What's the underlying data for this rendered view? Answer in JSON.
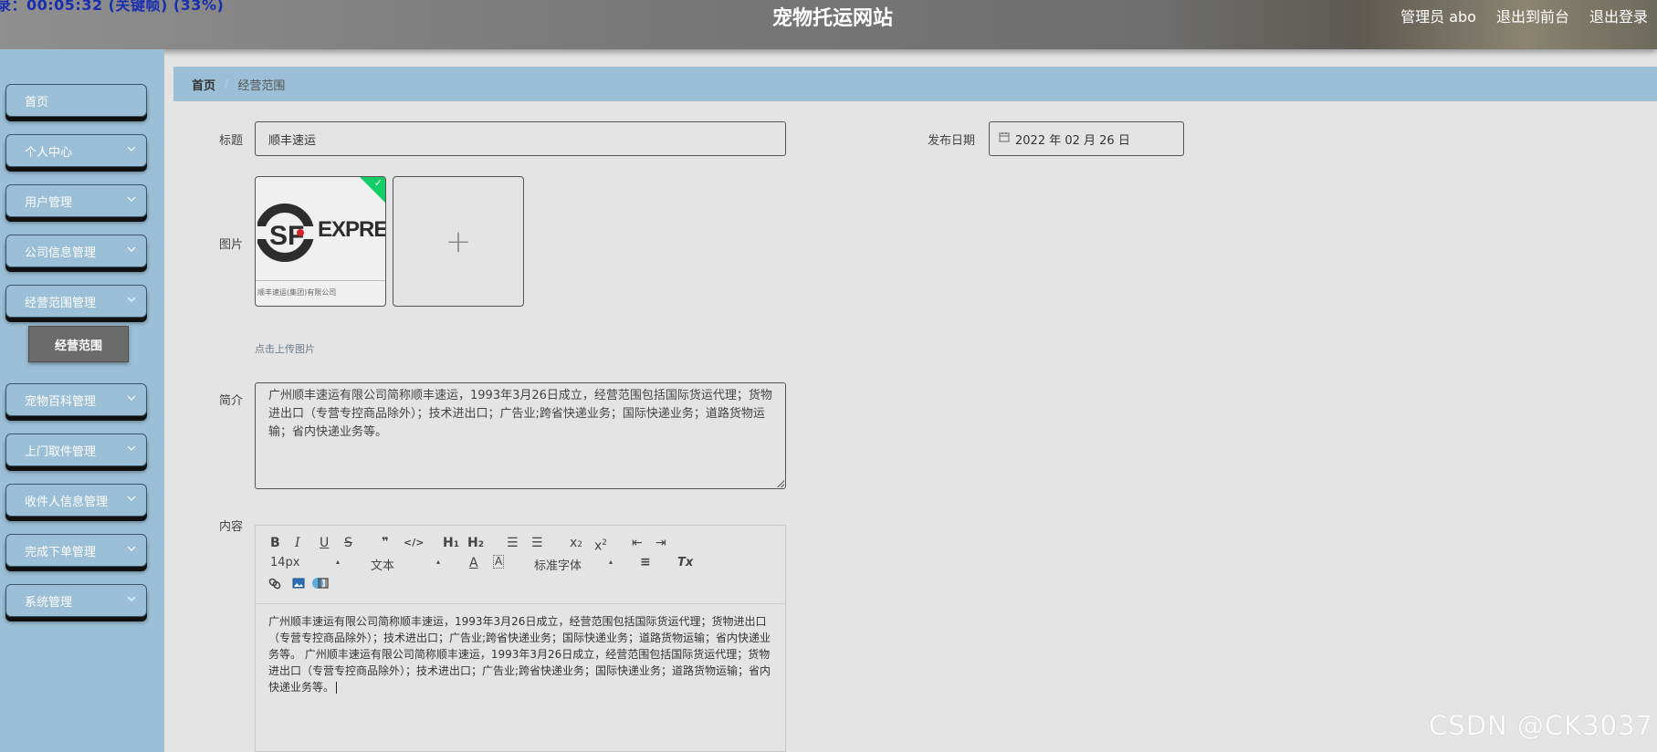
{
  "header": {
    "timer": "录：00:05:32 (关键帧) (33%)",
    "site_title": "宠物托运网站",
    "nav": {
      "user": "管理员 abo",
      "frontend": "退出到前台",
      "logout": "退出登录"
    }
  },
  "sidebar": {
    "items": [
      {
        "label": "首页",
        "has_arrow": false
      },
      {
        "label": "个人中心",
        "has_arrow": true
      },
      {
        "label": "用户管理",
        "has_arrow": true
      },
      {
        "label": "公司信息管理",
        "has_arrow": true
      },
      {
        "label": "经营范围管理",
        "has_arrow": true
      },
      {
        "label": "宠物百科管理",
        "has_arrow": true
      },
      {
        "label": "上门取件管理",
        "has_arrow": true
      },
      {
        "label": "收件人信息管理",
        "has_arrow": true
      },
      {
        "label": "完成下单管理",
        "has_arrow": true
      },
      {
        "label": "系统管理",
        "has_arrow": true
      }
    ],
    "submenu": {
      "label": "经营范围"
    }
  },
  "breadcrumb": {
    "home": "首页",
    "separator": "/",
    "current": "经营范围"
  },
  "form": {
    "title_label": "标题",
    "title_value": "顺丰速运",
    "date_label": "发布日期",
    "date_value": "2022 年 02 月 26 日",
    "image_label": "图片",
    "image": {
      "logo_text": "EXPRESS",
      "logo_letters": "SF",
      "caption": "顺丰速运(集团)有限公司"
    },
    "upload_add": "+",
    "upload_hint": "点击上传图片",
    "intro_label": "简介",
    "intro_value": "广州顺丰速运有限公司简称顺丰速运，1993年3月26日成立，经营范围包括国际货运代理；货物进出口（专营专控商品除外）；技术进出口；广告业;跨省快递业务；国际快递业务；道路货物运输；省内快递业务等。",
    "content_label": "内容"
  },
  "editor": {
    "toolbar_row1": {
      "bold": "B",
      "italic": "I",
      "underline": "U",
      "strike": "S",
      "quote": "❞",
      "code": "</>",
      "h1": "H",
      "h1_sub": "1",
      "h2": "H",
      "h2_sub": "2",
      "ol": "☰",
      "ul": "☰",
      "sub": "x",
      "sub_sub": "2",
      "sup": "x",
      "sup_sup": "2",
      "outdent": "⇤",
      "indent": "⇥"
    },
    "toolbar_row2": {
      "size": "14px",
      "header": "文本",
      "color": "A",
      "bg_color": "A",
      "font": "标准字体",
      "align": "≡",
      "clean": "Tx"
    },
    "toolbar_row3": {
      "link": "🔗",
      "image": "▣",
      "video": "🎞"
    },
    "content": "广州顺丰速运有限公司简称顺丰速运，1993年3月26日成立，经营范围包括国际货运代理；货物进出口（专营专控商品除外）；技术进出口；广告业;跨省快递业务；国际快递业务；道路货物运输；省内快递业务等。 广州顺丰速运有限公司简称顺丰速运，1993年3月26日成立，经营范围包括国际货运代理；货物进出口（专营专控商品除外）；技术进出口；广告业;跨省快递业务；国际快递业务；道路货物运输；省内快递业务等。"
  },
  "watermark": "CSDN @CK3037",
  "colors": {
    "sidebar_bg": "#9bbfd6",
    "page_bg": "#e4e4e4",
    "submenu_active": "#6b6b6b",
    "upload_success": "#13ce66"
  }
}
